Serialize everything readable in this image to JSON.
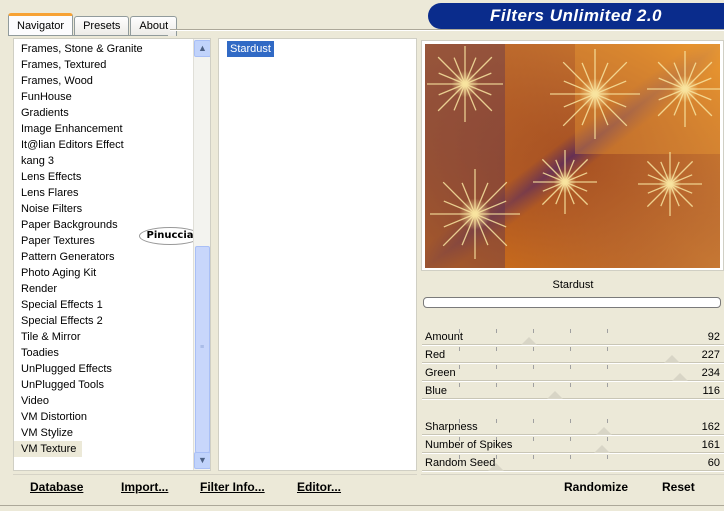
{
  "tabs": [
    {
      "label": "Navigator",
      "active": true
    },
    {
      "label": "Presets",
      "active": false
    },
    {
      "label": "About",
      "active": false
    }
  ],
  "banner": {
    "title": "Filters Unlimited 2.0",
    "color": "#0a2c8c"
  },
  "categories": [
    "Frames, Stone & Granite",
    "Frames, Textured",
    "Frames, Wood",
    "FunHouse",
    "Gradients",
    "Image Enhancement",
    "It@lian Editors Effect",
    "kang 3",
    "Lens Effects",
    "Lens Flares",
    "Noise Filters",
    "Paper Backgrounds",
    "Paper Textures",
    "Pattern Generators",
    "Photo Aging Kit",
    "Render",
    "Special Effects 1",
    "Special Effects 2",
    "Tile & Mirror",
    "Toadies",
    "UnPlugged Effects",
    "UnPlugged Tools",
    "Video",
    "VM Distortion",
    "VM Stylize",
    "VM Texture"
  ],
  "selected_category": "VM Texture",
  "watermark": "Pinuccia",
  "filters": [
    "Stardust"
  ],
  "selected_filter": "Stardust",
  "preview": {
    "filter_name": "Stardust",
    "colors": {
      "dark": "#5a2a5a",
      "orange": "#e07a10",
      "light": "#f0a040"
    }
  },
  "params_group1": [
    {
      "label": "Amount",
      "value": "92"
    },
    {
      "label": "Red",
      "value": "227"
    },
    {
      "label": "Green",
      "value": "234"
    },
    {
      "label": "Blue",
      "value": "116"
    }
  ],
  "params_group2": [
    {
      "label": "Sharpness",
      "value": "162"
    },
    {
      "label": "Number of Spikes",
      "value": "161"
    },
    {
      "label": "Random Seed",
      "value": "60"
    }
  ],
  "bottom_left_buttons": [
    "Database",
    "Import...",
    "Filter Info...",
    "Editor..."
  ],
  "bottom_right_buttons": [
    "Randomize",
    "Reset"
  ]
}
